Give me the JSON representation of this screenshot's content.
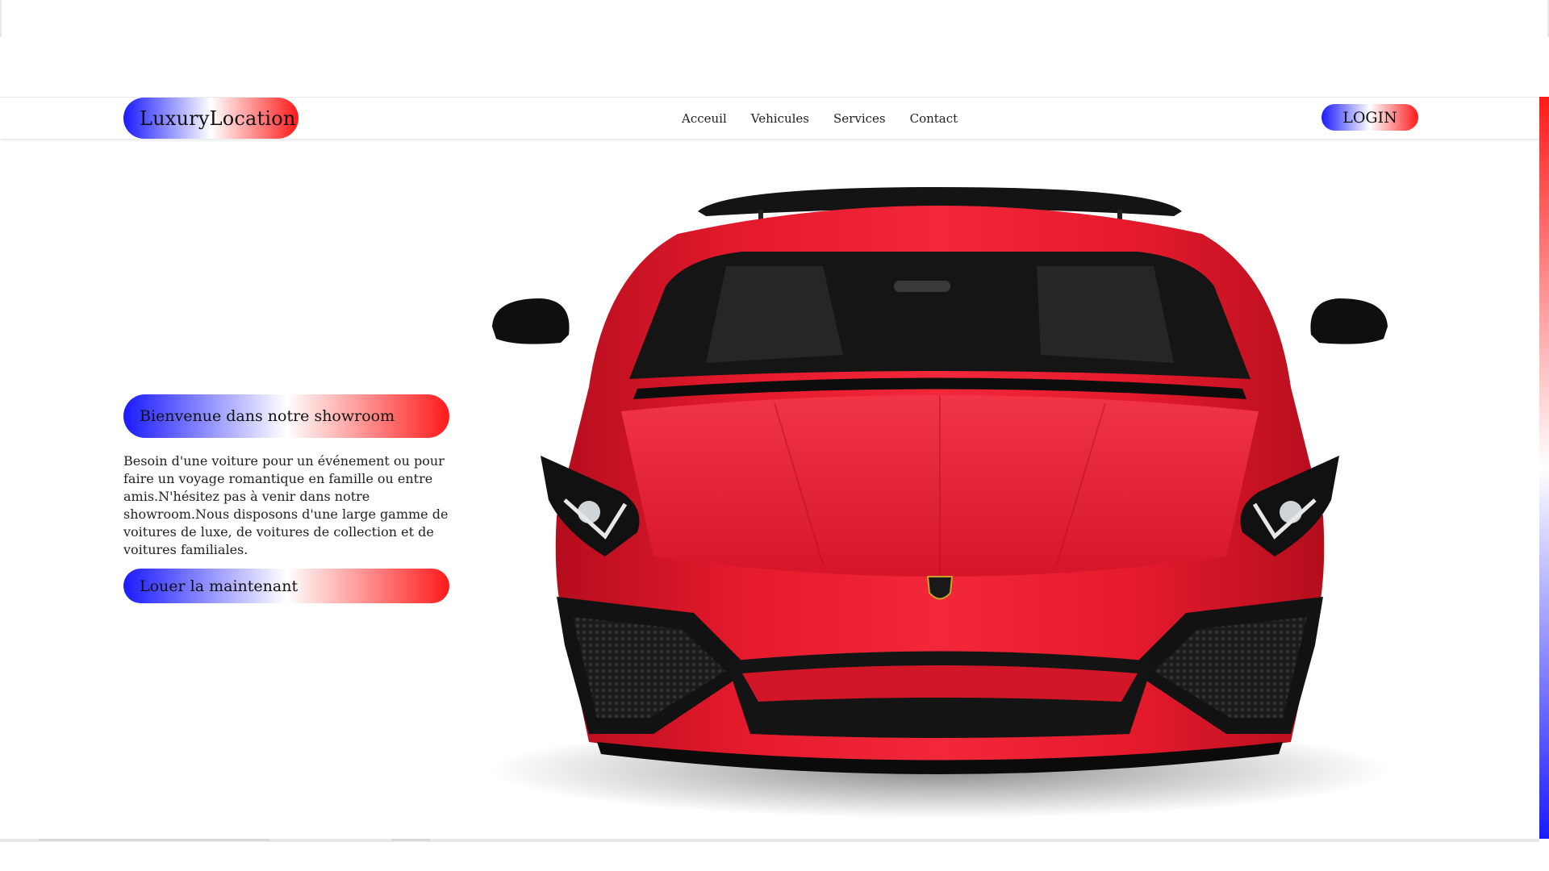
{
  "brand": {
    "logo_text": "LuxuryLocation"
  },
  "nav": {
    "items": [
      "Acceuil",
      "Vehicules",
      "Services",
      "Contact"
    ]
  },
  "header": {
    "login_label": "LOGIN"
  },
  "hero": {
    "title": "Bienvenue dans notre showroom",
    "description": "Besoin d'une voiture pour un événement ou pour faire un voyage romantique en famille ou entre amis.N'hésitez pas à venir dans notre showroom.Nous disposons d'une large gamme de voitures de luxe, de voitures de collection et de voitures familiales.",
    "cta_label": "Louer la maintenant"
  },
  "colors": {
    "gradient_blue": "#1a1aff",
    "gradient_red": "#ff1a1a",
    "car_red": "#e3162a"
  },
  "image": {
    "subject": "red-sports-car"
  }
}
